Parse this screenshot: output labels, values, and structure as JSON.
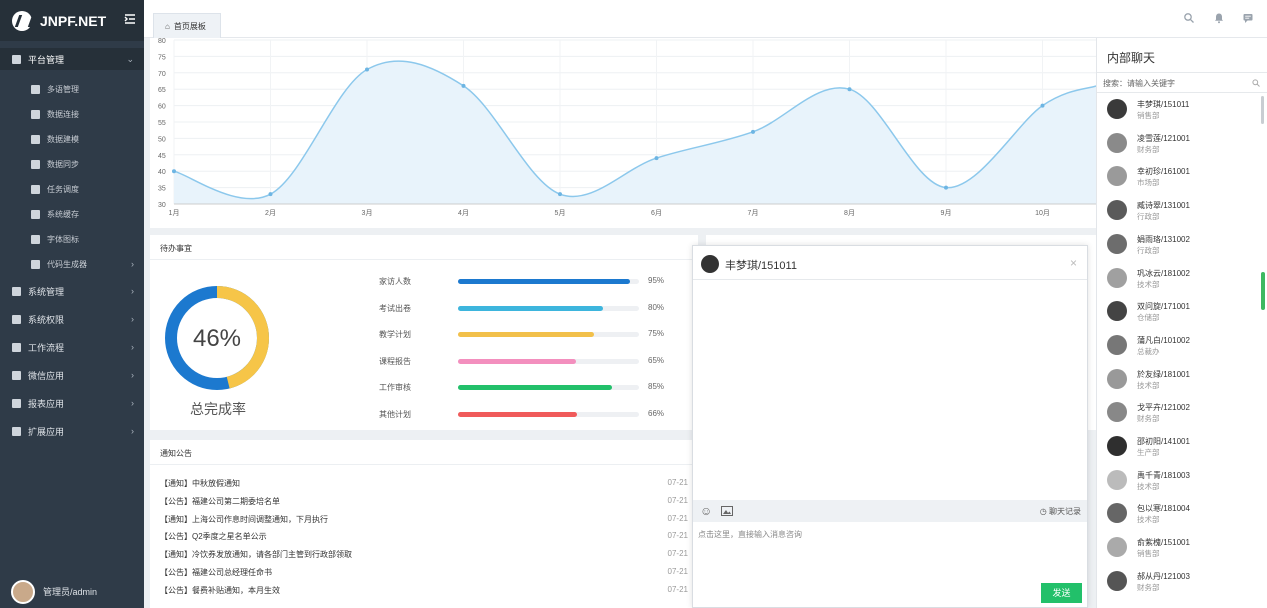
{
  "app": {
    "logo_text": "JNPF.NET"
  },
  "sidebar": {
    "group": {
      "label": "平台管理",
      "icon": "monitor-icon"
    },
    "sub_items": [
      {
        "label": "多语管理",
        "icon": "globe-icon"
      },
      {
        "label": "数据连接",
        "icon": "list-icon"
      },
      {
        "label": "数据建模",
        "icon": "model-icon"
      },
      {
        "label": "数据同步",
        "icon": "cloud-icon"
      },
      {
        "label": "任务调度",
        "icon": "calendar-icon"
      },
      {
        "label": "系统缓存",
        "icon": "cloud-icon"
      },
      {
        "label": "字体图标",
        "icon": "font-icon"
      },
      {
        "label": "代码生成器",
        "icon": "code-icon"
      }
    ],
    "items": [
      {
        "label": "系统管理",
        "icon": "tools-icon"
      },
      {
        "label": "系统权限",
        "icon": "shield-icon"
      },
      {
        "label": "工作流程",
        "icon": "share-icon"
      },
      {
        "label": "微信应用",
        "icon": "wechat-icon"
      },
      {
        "label": "报表应用",
        "icon": "chart-icon"
      },
      {
        "label": "扩展应用",
        "icon": "grid-icon"
      }
    ],
    "user": "管理员/admin"
  },
  "tabs": [
    {
      "label": "首页展板"
    }
  ],
  "chart_data": {
    "type": "area",
    "categories": [
      "1月",
      "2月",
      "3月",
      "4月",
      "5月",
      "6月",
      "7月",
      "8月",
      "9月",
      "10月"
    ],
    "values": [
      40,
      33,
      71,
      66,
      33,
      44,
      52,
      65,
      35,
      60
    ],
    "ylim": [
      30,
      80
    ],
    "yticks": [
      30,
      35,
      40,
      45,
      50,
      55,
      60,
      65,
      70,
      75,
      80
    ],
    "color": "#8cc8ec",
    "grid": true
  },
  "todo": {
    "title": "待办事宜",
    "donut_value": "46%",
    "donut_label": "总完成率",
    "donut_fraction": 0.46,
    "bars": [
      {
        "label": "家访人数",
        "pct": "95%",
        "value": 0.95,
        "color": "#1c79cf"
      },
      {
        "label": "考试出卷",
        "pct": "80%",
        "value": 0.8,
        "color": "#3db5dd"
      },
      {
        "label": "教学计划",
        "pct": "75%",
        "value": 0.75,
        "color": "#f2c04a"
      },
      {
        "label": "课程报告",
        "pct": "65%",
        "value": 0.65,
        "color": "#f38fbe"
      },
      {
        "label": "工作审核",
        "pct": "85%",
        "value": 0.85,
        "color": "#22c06a"
      },
      {
        "label": "其他计划",
        "pct": "66%",
        "value": 0.66,
        "color": "#f05a5a"
      }
    ]
  },
  "notices": {
    "title": "通知公告",
    "items": [
      {
        "text": "【通知】中秋放假通知",
        "date": "07-21"
      },
      {
        "text": "【公告】福建公司第二期委培名单",
        "date": "07-21"
      },
      {
        "text": "【通知】上海公司作息时间调整通知，下月执行",
        "date": "07-21"
      },
      {
        "text": "【公告】Q2季度之星名单公示",
        "date": "07-21"
      },
      {
        "text": "【通知】冷饮券发放通知，请各部门主管到行政部领取",
        "date": "07-21"
      },
      {
        "text": "【公告】福建公司总经理任命书",
        "date": "07-21"
      },
      {
        "text": "【公告】餐费补贴通知，本月生效",
        "date": "07-21"
      }
    ]
  },
  "chat": {
    "title": "丰梦琪/151011",
    "history_label": "聊天记录",
    "input_placeholder": "点击这里，直接输入消息咨询",
    "send_label": "发送"
  },
  "chatlist": {
    "title": "内部聊天",
    "search_placeholder": "搜索：请输入关键字",
    "contacts": [
      {
        "name": "丰梦琪/151011",
        "dept": "销售部"
      },
      {
        "name": "凌雪莲/121001",
        "dept": "财务部"
      },
      {
        "name": "幸初珍/161001",
        "dept": "市场部"
      },
      {
        "name": "臧诗翠/131001",
        "dept": "行政部"
      },
      {
        "name": "娟雨珞/131002",
        "dept": "行政部"
      },
      {
        "name": "巩冰云/181002",
        "dept": "技术部"
      },
      {
        "name": "双问旋/171001",
        "dept": "仓储部"
      },
      {
        "name": "蒲凡白/101002",
        "dept": "总裁办"
      },
      {
        "name": "於友绿/181001",
        "dept": "技术部"
      },
      {
        "name": "戈平卉/121002",
        "dept": "财务部"
      },
      {
        "name": "邵初阳/141001",
        "dept": "生产部"
      },
      {
        "name": "禹千青/181003",
        "dept": "技术部"
      },
      {
        "name": "包以寒/181004",
        "dept": "技术部"
      },
      {
        "name": "俞紫槐/151001",
        "dept": "销售部"
      },
      {
        "name": "郝从丹/121003",
        "dept": "财务部"
      }
    ]
  }
}
